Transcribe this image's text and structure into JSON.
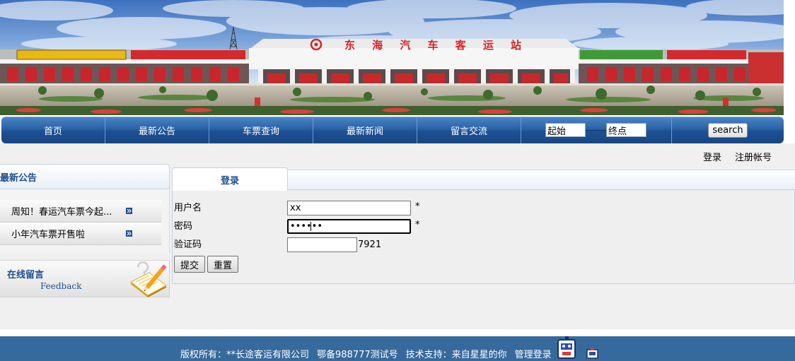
{
  "banner": {
    "sign": "东海汽车客运站"
  },
  "nav": {
    "items": [
      {
        "label": "首页"
      },
      {
        "label": "最新公告"
      },
      {
        "label": "车票查询"
      },
      {
        "label": "最新新闻"
      },
      {
        "label": "留言交流"
      }
    ],
    "search": {
      "from_value": "起始",
      "to_value": "终点",
      "button_label": "search"
    }
  },
  "user_links": {
    "login": "登录",
    "register": "注册帐号"
  },
  "sidebar": {
    "notice_title": "最新公告",
    "notices": [
      {
        "title": "周知！春运汽车票今起...",
        "icon": "arrow-right-icon"
      },
      {
        "title": "小年汽车票开售啦",
        "icon": "arrow-right-icon"
      }
    ],
    "feedback": {
      "title": "在线留言",
      "subtitle": "Feedback",
      "icon": "notepad-pencil-icon"
    }
  },
  "login": {
    "tab_label": "登录",
    "username": {
      "label": "用户名",
      "value": "xx",
      "required_mark": "*"
    },
    "password": {
      "label": "密码",
      "value": "••••••",
      "required_mark": "*"
    },
    "captcha": {
      "label": "验证码",
      "code": "7921"
    },
    "submit_label": "提交",
    "reset_label": "重置"
  },
  "footer": {
    "copyright": "版权所有：**长途客运有限公司",
    "icp": "鄂备988777测试号",
    "support": "技术支持：来自星星的你",
    "admin_link": "管理登录",
    "icons": [
      "mascot-icon",
      "badge-icon"
    ]
  },
  "colors": {
    "nav_top": "#4a86c8",
    "nav_bottom": "#174683",
    "heading_blue": "#1d4f91",
    "border_blue": "#c6d2e3",
    "page_gray": "#f0f0f0",
    "footer_blue": "#366a9d"
  }
}
